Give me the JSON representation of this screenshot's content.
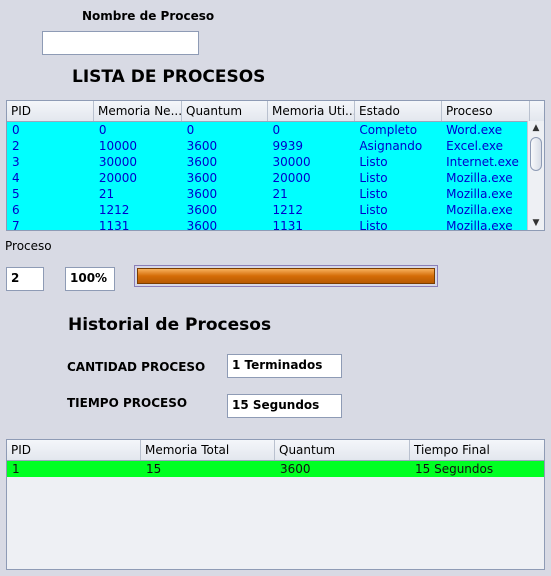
{
  "form": {
    "nombre_label": "Nombre de Proceso",
    "nombre_value": ""
  },
  "lista_title": "LISTA DE PROCESOS",
  "process_table": {
    "columns": [
      "PID",
      "Memoria Ne...",
      "Quantum",
      "Memoria Uti...",
      "Estado",
      "Proceso"
    ],
    "rows": [
      [
        "0",
        "0",
        "0",
        "0",
        "Completo",
        "Word.exe"
      ],
      [
        "2",
        "10000",
        "3600",
        "9939",
        "Asignando",
        "Excel.exe"
      ],
      [
        "3",
        "30000",
        "3600",
        "30000",
        "Listo",
        "Internet.exe"
      ],
      [
        "4",
        "20000",
        "3600",
        "20000",
        "Listo",
        "Mozilla.exe"
      ],
      [
        "5",
        "21",
        "3600",
        "21",
        "Listo",
        "Mozilla.exe"
      ],
      [
        "6",
        "1212",
        "3600",
        "1212",
        "Listo",
        "Mozilla.exe"
      ],
      [
        "7",
        "1131",
        "3600",
        "1131",
        "Listo",
        "Mozilla.exe"
      ]
    ],
    "row_color": "#00ffff"
  },
  "proceso": {
    "label": "Proceso",
    "pid_value": "2",
    "percent_value": "100%",
    "progress_fraction": 1.0
  },
  "historial": {
    "title": "Historial de Procesos",
    "cantidad_label": "CANTIDAD PROCESO",
    "cantidad_value": "1 Terminados",
    "tiempo_label": "TIEMPO PROCESO",
    "tiempo_value": "15 Segundos"
  },
  "history_table": {
    "columns": [
      "PID",
      "Memoria Total",
      "Quantum",
      "Tiempo Final"
    ],
    "rows": [
      [
        "1",
        "15",
        "3600",
        "15 Segundos"
      ]
    ],
    "row_color": "#00ff22"
  },
  "icons": {
    "scroll_up": "triangle-up",
    "scroll_down": "triangle-down"
  }
}
